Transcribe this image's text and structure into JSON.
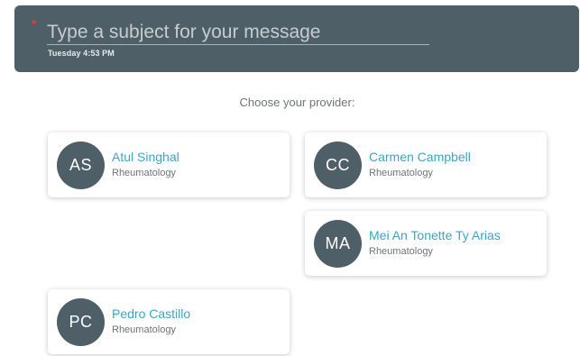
{
  "header": {
    "required_mark": "*",
    "subject_placeholder": "Type a subject for your message",
    "subject_value": "",
    "timestamp": "Tuesday 4:53 PM"
  },
  "prompt": "Choose your provider:",
  "providers": [
    {
      "initials": "AS",
      "name": "Atul Singhal",
      "specialty": "Rheumatology"
    },
    {
      "initials": "CC",
      "name": "Carmen Campbell",
      "specialty": "Rheumatology"
    },
    {
      "initials": "MA",
      "name": "Mei An Tonette Ty Arias",
      "specialty": "Rheumatology"
    },
    {
      "initials": "PC",
      "name": "Pedro Castillo",
      "specialty": "Rheumatology"
    }
  ],
  "colors": {
    "header_bg": "#4f5f68",
    "avatar_bg": "#4f5f68",
    "name_link": "#3aa6c6",
    "required": "#e2413a"
  }
}
